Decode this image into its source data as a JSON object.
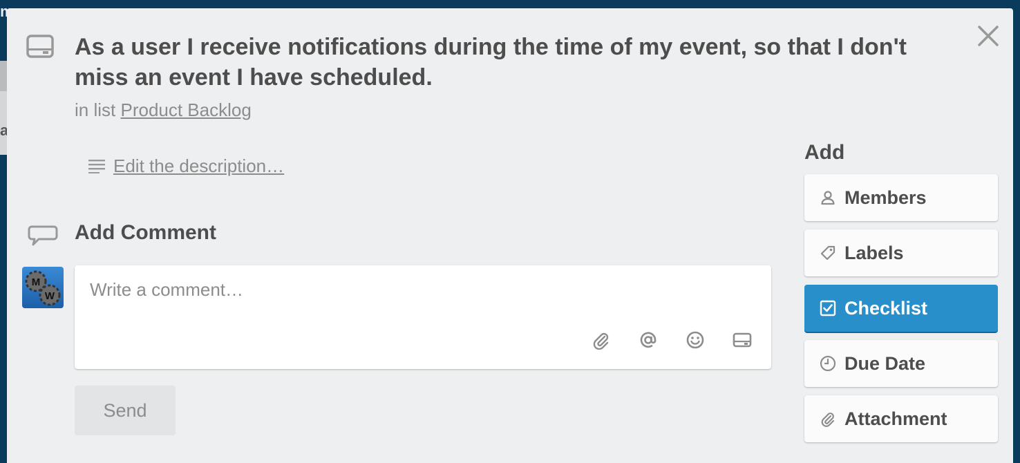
{
  "backdrop": {
    "top_char": "m",
    "mid_char": "a"
  },
  "card": {
    "title": "As a user I receive notifications during the time of my event, so that I don't miss an event I have scheduled.",
    "list_prefix": "in list",
    "list_name": "Product Backlog",
    "description_link": "Edit the description…"
  },
  "comment": {
    "heading": "Add Comment",
    "placeholder": "Write a comment…",
    "send_label": "Send",
    "avatar_letters": [
      "M",
      "W"
    ]
  },
  "sidebar": {
    "heading": "Add",
    "buttons": [
      {
        "label": "Members",
        "icon": "person-icon"
      },
      {
        "label": "Labels",
        "icon": "tag-icon"
      },
      {
        "label": "Checklist",
        "icon": "checkbox-icon",
        "active": true
      },
      {
        "label": "Due Date",
        "icon": "clock-icon"
      },
      {
        "label": "Attachment",
        "icon": "paperclip-icon"
      }
    ]
  },
  "colors": {
    "accent": "#298fca",
    "window_bg": "#edeff0",
    "board_bg": "#0a3a5c",
    "text": "#4d4d4d",
    "muted": "#8c8c8c"
  }
}
